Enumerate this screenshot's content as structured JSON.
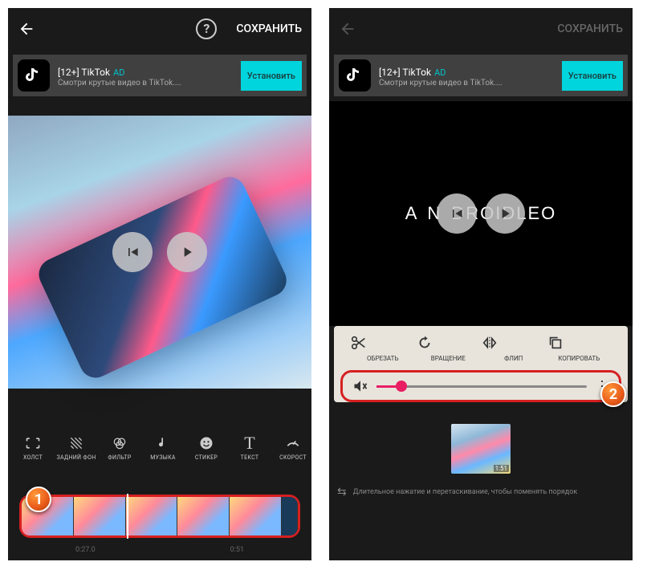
{
  "left": {
    "save": "СОХРАНИТЬ",
    "ad": {
      "title": "[12+] TikTok",
      "tag": "AD",
      "sub": "Смотри крутые видео в TikTok....",
      "install": "Установить"
    },
    "tools": [
      {
        "icon": "⛶",
        "label": "ХОЛСТ"
      },
      {
        "icon": "◢",
        "label": "ЗАДНИЙ ФОН"
      },
      {
        "icon": "◉",
        "label": "ФИЛЬТР"
      },
      {
        "icon": "♪",
        "label": "МУЗЫКА"
      },
      {
        "icon": "☺",
        "label": "СТИКЕР"
      },
      {
        "icon": "T",
        "label": "ТЕКСТ"
      },
      {
        "icon": "◔",
        "label": "СКОРОСТ"
      }
    ],
    "times": [
      "0:27.0",
      "0:51"
    ],
    "marker": "1"
  },
  "right": {
    "save": "СОХРАНИТЬ",
    "ad": {
      "title": "[12+] TikTok",
      "tag": "AD",
      "sub": "Смотри крутые видео в TikTok....",
      "install": "Установить"
    },
    "logo_mid": "DROIDLEO",
    "edit_tools": [
      {
        "icon": "cut",
        "label": "ОБРЕЗАТЬ"
      },
      {
        "icon": "rotate",
        "label": "ВРАЩЕНИЕ"
      },
      {
        "icon": "flip",
        "label": "ФЛИП"
      },
      {
        "icon": "copy",
        "label": "КОПИРОВАТЬ"
      }
    ],
    "clip_duration": "1:51",
    "hint": "Длительное нажатие и перетаскивание, чтобы поменять порядок",
    "marker": "2"
  }
}
